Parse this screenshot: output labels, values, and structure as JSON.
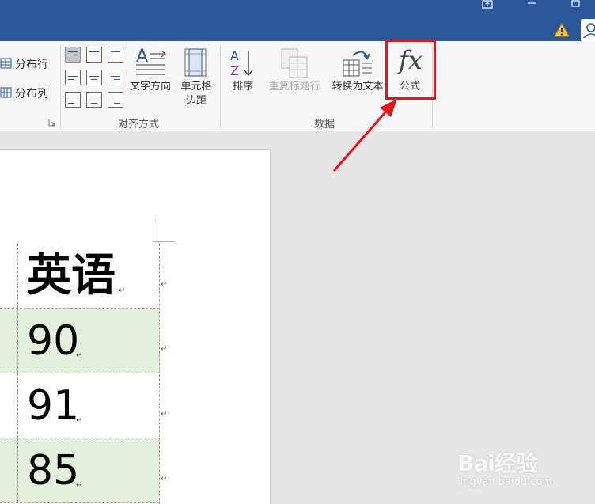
{
  "ribbon": {
    "distribute_rows": "分布行",
    "distribute_cols": "分布列",
    "alignment_group": "对齐方式",
    "data_group": "数据",
    "text_direction": "文字方向",
    "cell_margins_line1": "单元格",
    "cell_margins_line2": "边距",
    "sort": "排序",
    "repeat_header": "重复标题行",
    "convert_to_text": "转换为文本",
    "formula": "公式",
    "formula_glyph": "fx"
  },
  "table": {
    "header": "英语",
    "rows": [
      "90",
      "91",
      "85"
    ],
    "cell_mark": "↵"
  },
  "watermark": {
    "brand": "Bai经验",
    "url": "jingyan.baidu.com"
  },
  "colors": {
    "titlebar": "#2b579a",
    "highlight": "#e8141c",
    "row_green": "#e2efda"
  }
}
